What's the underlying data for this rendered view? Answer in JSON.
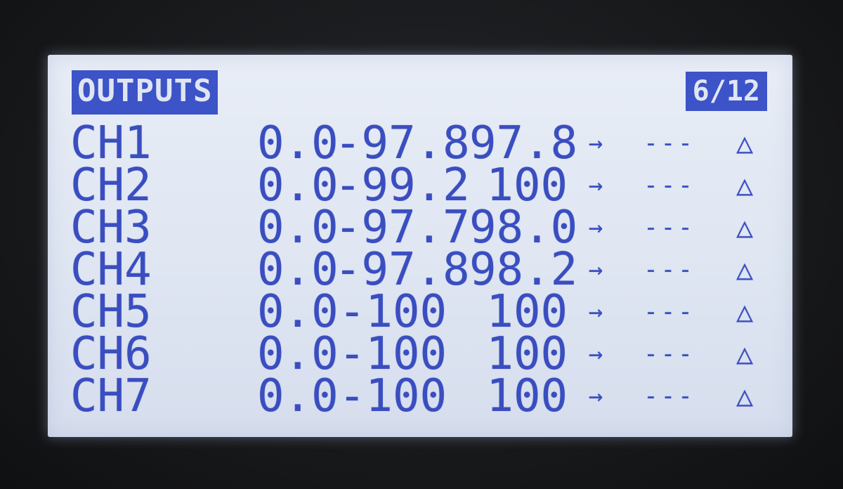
{
  "screen": {
    "title": "OUTPUTS",
    "page": "6/12"
  },
  "channels": [
    {
      "name": "CH1",
      "offset": "0.0",
      "min": "-97.8",
      "max": "97.8",
      "arrow": "→",
      "dest": "---",
      "tri": "△"
    },
    {
      "name": "CH2",
      "offset": "0.0",
      "min": "-99.2",
      "max": "100",
      "arrow": "→",
      "dest": "---",
      "tri": "△"
    },
    {
      "name": "CH3",
      "offset": "0.0",
      "min": "-97.7",
      "max": "98.0",
      "arrow": "→",
      "dest": "---",
      "tri": "△"
    },
    {
      "name": "CH4",
      "offset": "0.0",
      "min": "-97.8",
      "max": "98.2",
      "arrow": "→",
      "dest": "---",
      "tri": "△"
    },
    {
      "name": "CH5",
      "offset": "0.0",
      "min": "-100",
      "max": "100",
      "arrow": "→",
      "dest": "---",
      "tri": "△"
    },
    {
      "name": "CH6",
      "offset": "0.0",
      "min": "-100",
      "max": "100",
      "arrow": "→",
      "dest": "---",
      "tri": "△"
    },
    {
      "name": "CH7",
      "offset": "0.0",
      "min": "-100",
      "max": "100",
      "arrow": "→",
      "dest": "---",
      "tri": "△"
    }
  ],
  "colors": {
    "lcd_background": "#e1e7f3",
    "lcd_text": "#3a4ec0",
    "bezel": "#1b1c1f"
  }
}
